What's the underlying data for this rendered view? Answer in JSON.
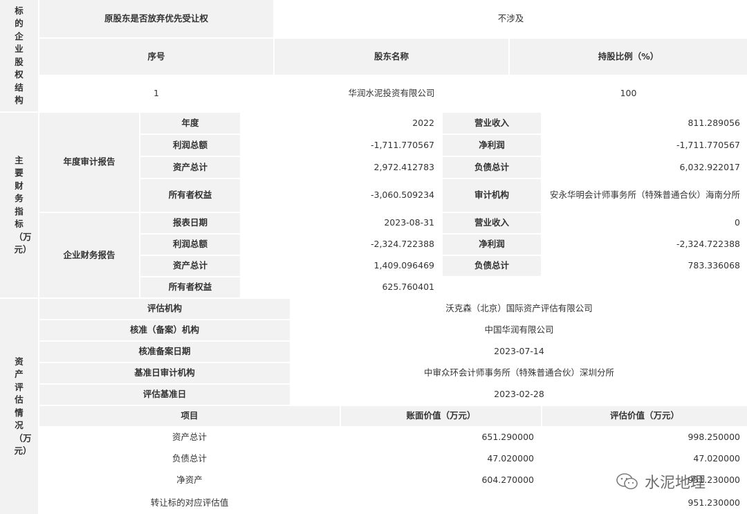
{
  "s1": {
    "label": "标的企业股权结构",
    "waiver_label": "原股东是否放弃优先受让权",
    "waiver_value": "不涉及",
    "headers": [
      "序号",
      "股东名称",
      "持股比例（%）"
    ],
    "row": [
      "1",
      "华润水泥投资有限公司",
      "100"
    ]
  },
  "s2": {
    "label": "主要财务指标（万元）",
    "audit": {
      "group": "年度审计报告",
      "l1": "年度",
      "v1": "2022",
      "l2": "营业收入",
      "v2": "811.289056",
      "l3": "利润总额",
      "v3": "-1,711.770567",
      "l4": "净利润",
      "v4": "-1,711.770567",
      "l5": "资产总计",
      "v5": "2,972.412783",
      "l6": "负债总计",
      "v6": "6,032.922017",
      "l7": "所有者权益",
      "v7": "-3,060.509234",
      "l8": "审计机构",
      "v8": "安永华明会计师事务所（特殊普通合伙）海南分所"
    },
    "report": {
      "group": "企业财务报告",
      "l1": "报表日期",
      "v1": "2023-08-31",
      "l2": "营业收入",
      "v2": "0",
      "l3": "利润总额",
      "v3": "-2,324.722388",
      "l4": "净利润",
      "v4": "-2,324.722388",
      "l5": "资产总计",
      "v5": "1,409.096469",
      "l6": "负债总计",
      "v6": "783.336068",
      "l7": "所有者权益",
      "v7": "625.760401"
    }
  },
  "s3": {
    "label": "资产评估情况（万元）",
    "l1": "评估机构",
    "v1": "沃克森（北京）国际资产评估有限公司",
    "l2": "核准（备案）机构",
    "v2": "中国华润有限公司",
    "l3": "核准备案日期",
    "v3": "2023-07-14",
    "l4": "基准日审计机构",
    "v4": "中审众环会计师事务所（特殊普通合伙）深圳分所",
    "l5": "评估基准日",
    "v5": "2023-02-28",
    "headers": [
      "项目",
      "账面价值（万元）",
      "评估价值（万元）"
    ],
    "rows": [
      {
        "item": "资产总计",
        "book": "651.290000",
        "eval": "998.250000"
      },
      {
        "item": "负债总计",
        "book": "47.020000",
        "eval": "47.020000"
      },
      {
        "item": "净资产",
        "book": "604.270000",
        "eval": "951.230000"
      }
    ],
    "transfer_label": "转让标的对应评估值",
    "transfer_value": "951.230000"
  },
  "watermark": "水泥地理"
}
